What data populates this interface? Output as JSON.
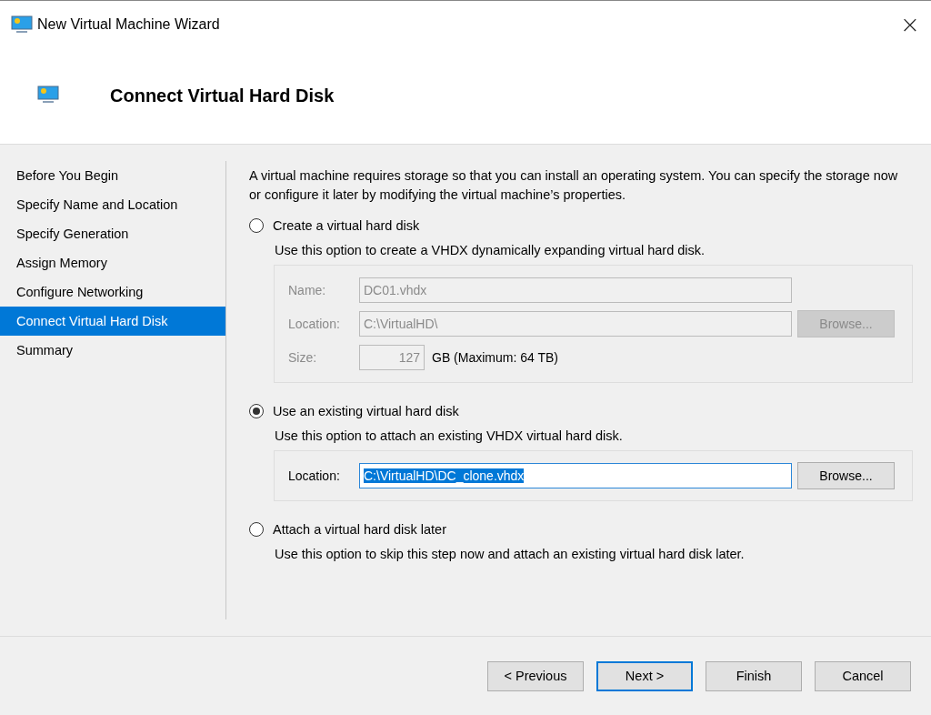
{
  "window": {
    "title": "New Virtual Machine Wizard",
    "close": "×"
  },
  "header": {
    "title": "Connect Virtual Hard Disk"
  },
  "steps": [
    {
      "label": "Before You Begin",
      "selected": false
    },
    {
      "label": "Specify Name and Location",
      "selected": false
    },
    {
      "label": "Specify Generation",
      "selected": false
    },
    {
      "label": "Assign Memory",
      "selected": false
    },
    {
      "label": "Configure Networking",
      "selected": false
    },
    {
      "label": "Connect Virtual Hard Disk",
      "selected": true
    },
    {
      "label": "Summary",
      "selected": false
    }
  ],
  "intro": "A virtual machine requires storage so that you can install an operating system. You can specify the storage now or configure it later by modifying the virtual machine’s properties.",
  "options": [
    {
      "label": "Create a virtual hard disk",
      "selected": false,
      "description": "Use this option to create a VHDX dynamically expanding virtual hard disk.",
      "panel": {
        "kind": "new_disk",
        "disabled": true,
        "name_label": "Name:",
        "name_value": "DC01.vhdx",
        "location_label": "Location:",
        "location_value": "C:\\VirtualHD\\",
        "browse": "Browse...",
        "size_label": "Size:",
        "size_value": "127",
        "size_unit": "GB (Maximum: 64 TB)"
      }
    },
    {
      "label": "Use an existing virtual hard disk",
      "selected": true,
      "description": "Use this option to attach an existing VHDX virtual hard disk.",
      "panel": {
        "kind": "existing_disk",
        "disabled": false,
        "location_label": "Location:",
        "location_value": "C:\\VirtualHD\\DC_clone.vhdx",
        "value_selected": true,
        "browse": "Browse..."
      }
    },
    {
      "label": "Attach a virtual hard disk later",
      "selected": false,
      "description": "Use this option to skip this step now and attach an existing virtual hard disk later."
    }
  ],
  "buttons": [
    {
      "label": "< Previous",
      "focused": false
    },
    {
      "label": "Next >",
      "focused": true
    },
    {
      "label": "Finish",
      "focused": false
    },
    {
      "label": "Cancel",
      "focused": false
    }
  ]
}
